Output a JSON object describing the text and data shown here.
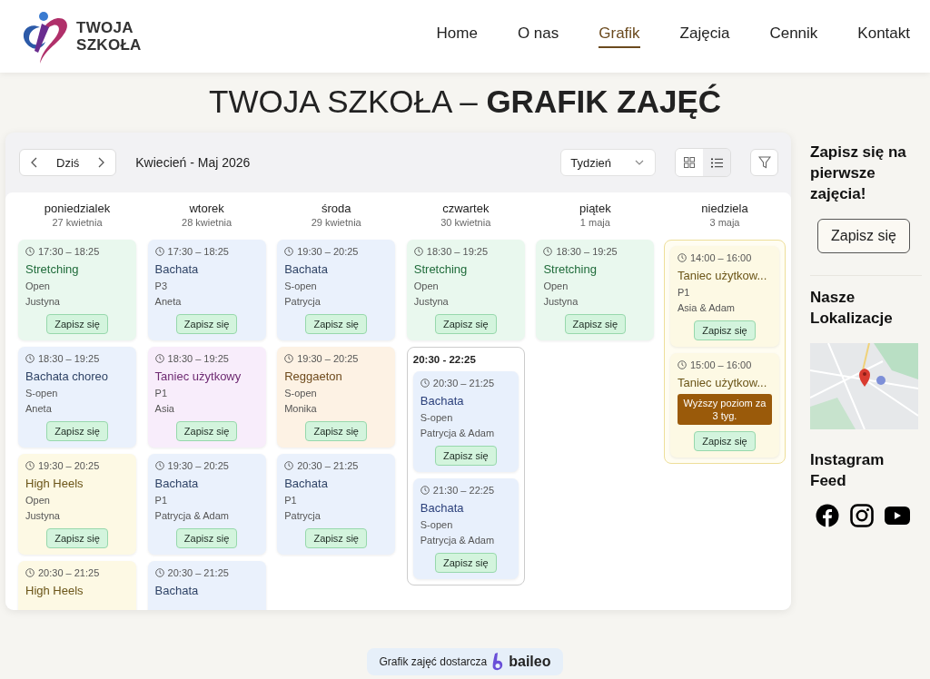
{
  "logo": {
    "lines": [
      "TWOJA",
      "SZKOŁA"
    ]
  },
  "nav": [
    {
      "label": "Home",
      "selected": false
    },
    {
      "label": "O nas",
      "selected": false
    },
    {
      "label": "Grafik",
      "selected": true
    },
    {
      "label": "Zajęcia",
      "selected": false
    },
    {
      "label": "Cennik",
      "selected": false
    },
    {
      "label": "Kontakt",
      "selected": false
    }
  ],
  "page_title": "TWOJA SZKOŁA – **GRAFIK ZAJĘĆ**",
  "toolbar": {
    "today": "Dziś",
    "range": "Kwiecień - Maj 2026",
    "view_select": "Tydzień",
    "view_toggle": [
      {
        "kind": "grid",
        "selected": false
      },
      {
        "kind": "list",
        "selected": true
      }
    ]
  },
  "days": [
    {
      "name": "poniedzialek",
      "date": "27 kwietnia",
      "items": [
        {
          "kind": "class",
          "color": "#1f6b3a",
          "time": "17:30 – 18:25",
          "title": "Stretching",
          "level": "Open",
          "teacher": "Justyna",
          "button": "Zapisz się"
        },
        {
          "kind": "class",
          "color": "#2f4366",
          "time": "18:30 – 19:25",
          "title": "Bachata choreo",
          "level": "S-open",
          "teacher": "Aneta",
          "button": "Zapisz się"
        },
        {
          "kind": "class",
          "color": "#6b5518",
          "time": "19:30 – 20:25",
          "title": "High Heels",
          "level": "Open",
          "teacher": "Justyna",
          "button": "Zapisz się"
        },
        {
          "kind": "class",
          "color": "#6b5518",
          "time": "20:30 – 21:25",
          "title": "High Heels"
        }
      ]
    },
    {
      "name": "wtorek",
      "date": "28 kwietnia",
      "items": [
        {
          "kind": "class",
          "color": "#2f4366",
          "time": "17:30 – 18:25",
          "title": "Bachata",
          "level": "P3",
          "teacher": "Aneta",
          "button": "Zapisz się"
        },
        {
          "kind": "class",
          "color": "#6e2a72",
          "time": "18:30 – 19:25",
          "title": "Taniec użytkowy",
          "level": "P1",
          "teacher": "Asia",
          "button": "Zapisz się"
        },
        {
          "kind": "class",
          "color": "#2f4366",
          "time": "19:30 – 20:25",
          "title": "Bachata",
          "level": "P1",
          "teacher": "Patrycja & Adam",
          "button": "Zapisz się"
        },
        {
          "kind": "class",
          "color": "#2f4366",
          "time": "20:30 – 21:25",
          "title": "Bachata"
        }
      ]
    },
    {
      "name": "środa",
      "date": "29 kwietnia",
      "items": [
        {
          "kind": "class",
          "color": "#2f4366",
          "time": "19:30 – 20:25",
          "title": "Bachata",
          "level": "S-open",
          "teacher": "Patrycja",
          "button": "Zapisz się"
        },
        {
          "kind": "class",
          "color": "#6e4a1c",
          "time": "19:30 – 20:25",
          "title": "Reggaeton",
          "level": "S-open",
          "teacher": "Monika",
          "button": "Zapisz się"
        },
        {
          "kind": "class",
          "color": "#2f4366",
          "time": "20:30 – 21:25",
          "title": "Bachata",
          "level": "P1",
          "teacher": "Patrycja",
          "button": "Zapisz się"
        }
      ]
    },
    {
      "name": "czwartek",
      "date": "30 kwietnia",
      "items": [
        {
          "kind": "class",
          "color": "#1f6b3a",
          "time": "18:30 – 19:25",
          "title": "Stretching",
          "level": "Open",
          "teacher": "Justyna",
          "button": "Zapisz się"
        },
        {
          "kind": "group",
          "label": "20:30 - 22:25",
          "children": [
            {
              "color": "#2a3f7a",
              "time": "20:30 – 21:25",
              "title": "Bachata",
              "level": "S-open",
              "teacher": "Patrycja & Adam",
              "button": "Zapisz się"
            },
            {
              "color": "#2a3f7a",
              "time": "21:30 – 22:25",
              "title": "Bachata",
              "level": "S-open",
              "teacher": "Patrycja & Adam",
              "button": "Zapisz się"
            }
          ]
        }
      ]
    },
    {
      "name": "piątek",
      "date": "1 maja",
      "items": [
        {
          "kind": "class",
          "color": "#1f6b3a",
          "time": "18:30 – 19:25",
          "title": "Stretching",
          "level": "Open",
          "teacher": "Justyna",
          "button": "Zapisz się"
        }
      ]
    },
    {
      "name": "niedziela",
      "date": "3 maja",
      "items": [
        {
          "kind": "group",
          "children": [
            {
              "color": "#6b5518",
              "time": "14:00 – 16:00",
              "title": "Taniec użytkow...",
              "level": "P1",
              "teacher": "Asia & Adam",
              "button": "Zapisz się"
            },
            {
              "color": "#6b5518",
              "time": "15:00 – 16:00",
              "title": "Taniec użytkow...",
              "notice": "Wyższy poziom za 3 tyg.",
              "button": "Zapisz się"
            }
          ]
        }
      ]
    }
  ],
  "sidebar": {
    "cta_heading": "Zapisz się na pierwsze zajęcia!",
    "cta_button": "Zapisz się",
    "locations_heading": "Nasze Lokalizacje",
    "feed_heading": "Instagram Feed"
  },
  "footer": {
    "text": "Grafik zajęć dostarcza",
    "brand": "baileo"
  }
}
